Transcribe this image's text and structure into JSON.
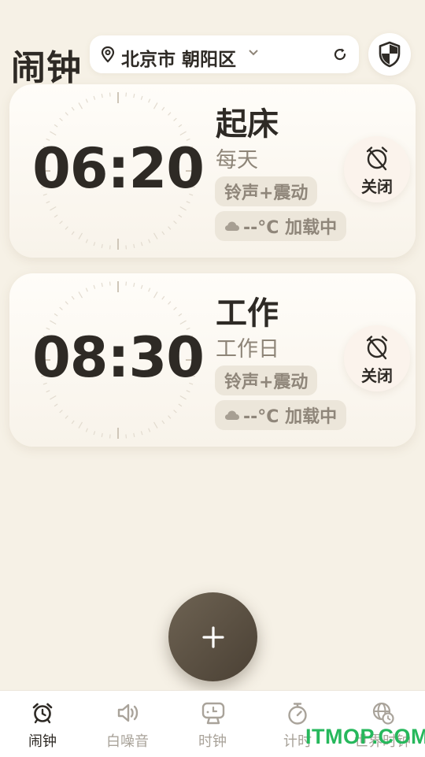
{
  "header": {
    "title": "闹钟",
    "location": "北京市 朝阳区"
  },
  "alarms": [
    {
      "time": "06:20",
      "name": "起床",
      "repeat": "每天",
      "sound": "铃声+震动",
      "weather": "--°C 加载中",
      "toggle_label": "关闭"
    },
    {
      "time": "08:30",
      "name": "工作",
      "repeat": "工作日",
      "sound": "铃声+震动",
      "weather": "--°C 加载中",
      "toggle_label": "关闭"
    }
  ],
  "fab": {
    "label": "+"
  },
  "bottom_nav": [
    {
      "label": "闹钟",
      "icon": "alarm-clock-icon",
      "active": true
    },
    {
      "label": "白噪音",
      "icon": "speaker-icon",
      "active": false
    },
    {
      "label": "时钟",
      "icon": "desk-clock-icon",
      "active": false
    },
    {
      "label": "计时",
      "icon": "stopwatch-icon",
      "active": false
    },
    {
      "label": "世界时钟",
      "icon": "world-clock-icon",
      "active": false
    }
  ],
  "watermark": "ITMOP.COM",
  "colors": {
    "background": "#f6f1e6",
    "text": "#2e2a25",
    "muted": "#8e8578",
    "chip": "#ece6da",
    "fab": "#5a4f42",
    "watermark": "#26b85c"
  }
}
